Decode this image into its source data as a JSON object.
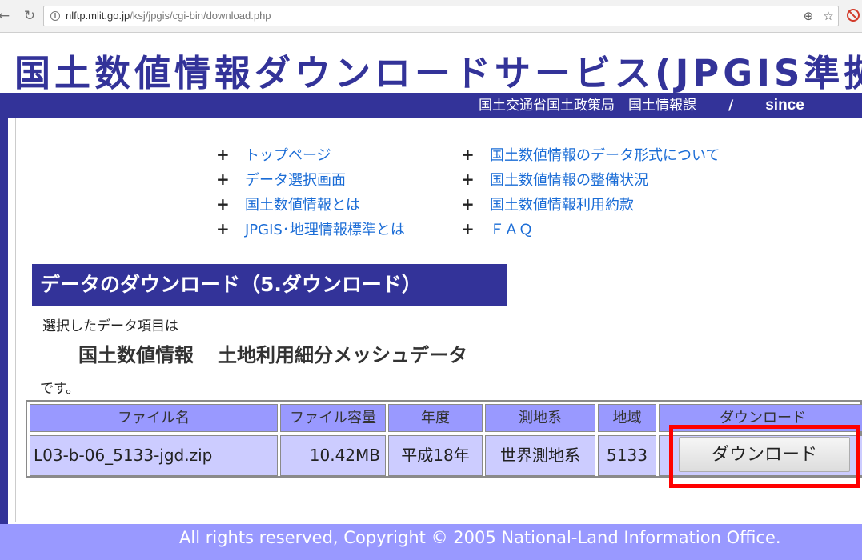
{
  "browser": {
    "url_host": "nlftp.mlit.go.jp",
    "url_path": "/ksj/jpgis/cgi-bin/download.php",
    "back_glyph": "←",
    "reload_glyph": "↻",
    "zoom_glyph": "⊕",
    "star_glyph": "☆"
  },
  "header": {
    "title": "国土数値情報ダウンロードサービス(JPGIS準拠",
    "org": "国土交通省国土政策局　国土情報課",
    "separator": "/",
    "since": "since"
  },
  "nav": {
    "plus": "+",
    "left": [
      {
        "label": "トップページ"
      },
      {
        "label": "データ選択画面"
      },
      {
        "label": "国土数値情報とは"
      },
      {
        "label": "JPGIS･地理情報標準とは"
      }
    ],
    "right": [
      {
        "label": "国土数値情報のデータ形式について"
      },
      {
        "label": "国土数値情報の整備状況"
      },
      {
        "label": "国土数値情報利用約款"
      },
      {
        "label": "ＦＡＱ"
      }
    ]
  },
  "section": {
    "title": "データのダウンロード（5.ダウンロード）",
    "intro": "選択したデータ項目は",
    "dataset_part1": "国土数値情報",
    "dataset_part2": "土地利用細分メッシュデータ",
    "suffix": "です。"
  },
  "table": {
    "headers": [
      "ファイル名",
      "ファイル容量",
      "年度",
      "測地系",
      "地域",
      "ダウンロード"
    ],
    "row": {
      "filename": "L03-b-06_5133-jgd.zip",
      "size": "10.42MB",
      "year": "平成18年",
      "datum": "世界測地系",
      "region": "5133",
      "button_label": "ダウンロード"
    }
  },
  "footer": {
    "copyright": "All rights reserved, Copyright © 2005 National-Land Information Office."
  },
  "colors": {
    "brand_navy": "#333399",
    "table_head": "#9999ff",
    "table_body": "#ccccff",
    "link": "#1a6cd6",
    "highlight": "#ff0000"
  }
}
